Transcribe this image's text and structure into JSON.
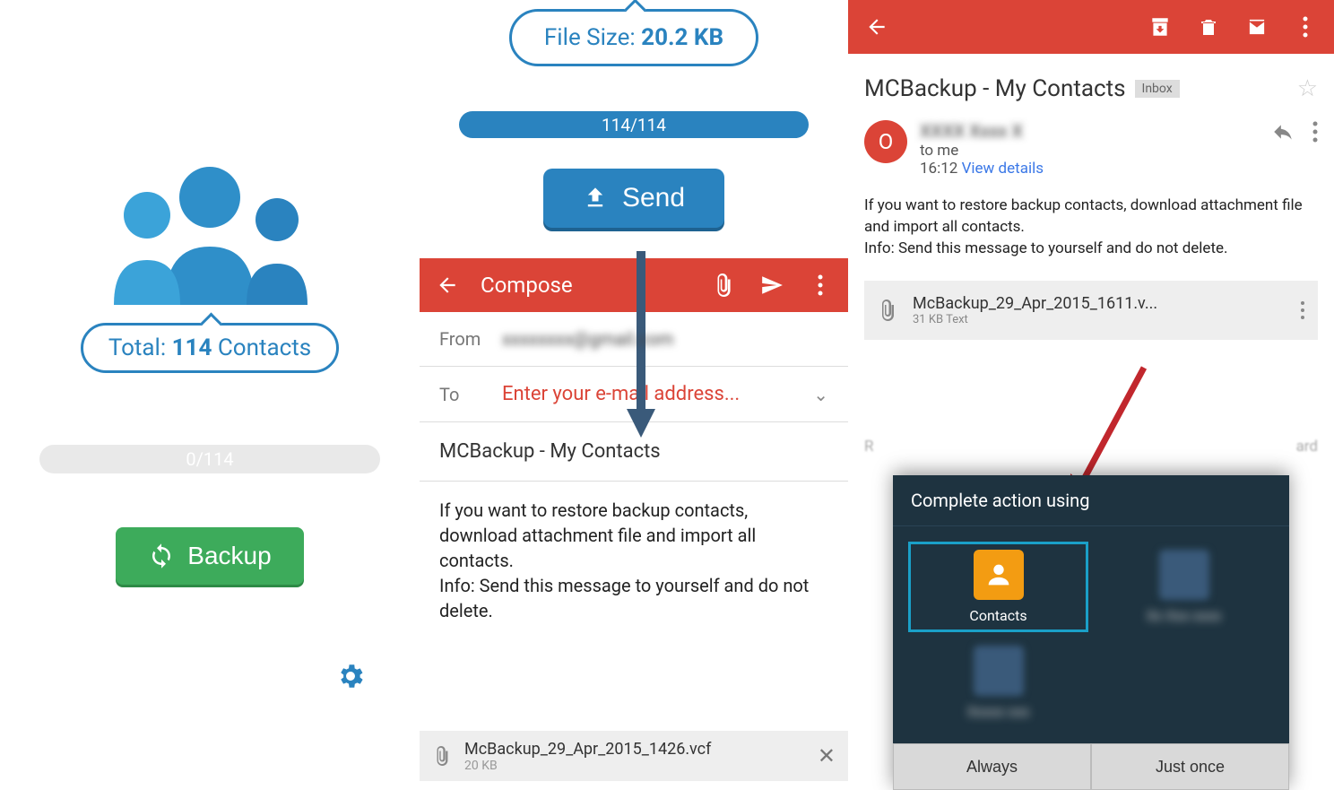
{
  "panel1": {
    "total_label": "Total: ",
    "total_count": "114",
    "total_suffix": " Contacts",
    "progress": "0/114",
    "backup_label": "Backup"
  },
  "panel2": {
    "filesize_label": "File Size: ",
    "filesize_value": "20.2 KB",
    "progress": "114/114",
    "send_label": "Send",
    "compose_title": "Compose",
    "from_label": "From",
    "from_value": "xxxxxxxx@gmail.com",
    "to_label": "To",
    "to_placeholder": "Enter your e-mail address...",
    "subject": "MCBackup - My Contacts",
    "body": "If you want to restore backup contacts, download attachment file and import all contacts.\nInfo: Send this message to yourself and do not delete.",
    "attachment_name": "McBackup_29_Apr_2015_1426.vcf",
    "attachment_size": "20 KB"
  },
  "panel3": {
    "subject": "MCBackup - My Contacts",
    "inbox_chip": "Inbox",
    "avatar_letter": "O",
    "sender_name": "XXXX Xxxx X",
    "to_me": "to me",
    "time": "16:12",
    "view_details": "View details",
    "body": "If you want to restore backup contacts, download attachment file and import all contacts.\nInfo: Send this message to yourself and do not delete.",
    "attachment_name": "McBackup_29_Apr_2015_1611.v...",
    "attachment_meta": "31 KB Text",
    "chooser_title": "Complete action using",
    "chooser_contacts": "Contacts",
    "always_label": "Always",
    "justonce_label": "Just once",
    "behind_left": "R",
    "behind_right": "ard"
  }
}
